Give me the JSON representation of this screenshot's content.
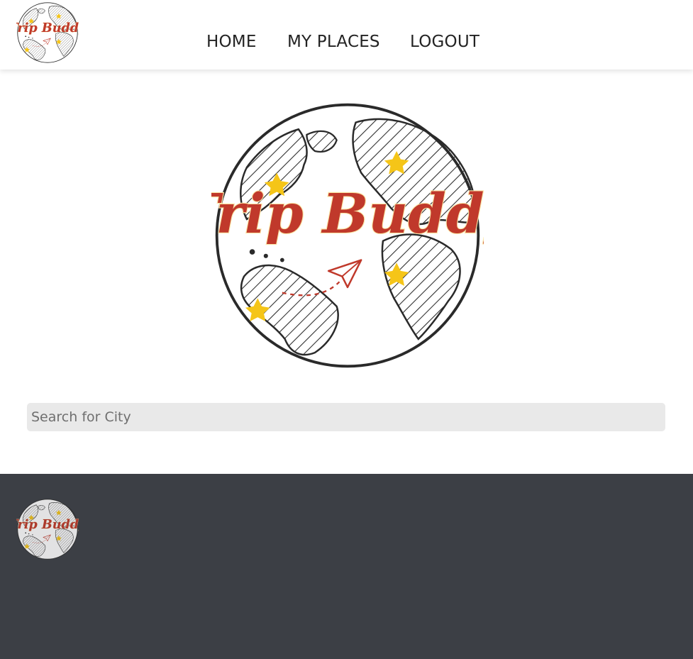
{
  "brand": {
    "name": "Trip Buddy",
    "colors": {
      "accent": "#c0392b",
      "star": "#f5c518",
      "footer_bg": "#3c3f45",
      "search_bg": "#e9e9e9"
    },
    "logo_icon": "globe-logo"
  },
  "nav": {
    "home": "HOME",
    "my_places": "MY PLACES",
    "logout": "LOGOUT"
  },
  "search": {
    "placeholder": "Search for City",
    "value": ""
  }
}
